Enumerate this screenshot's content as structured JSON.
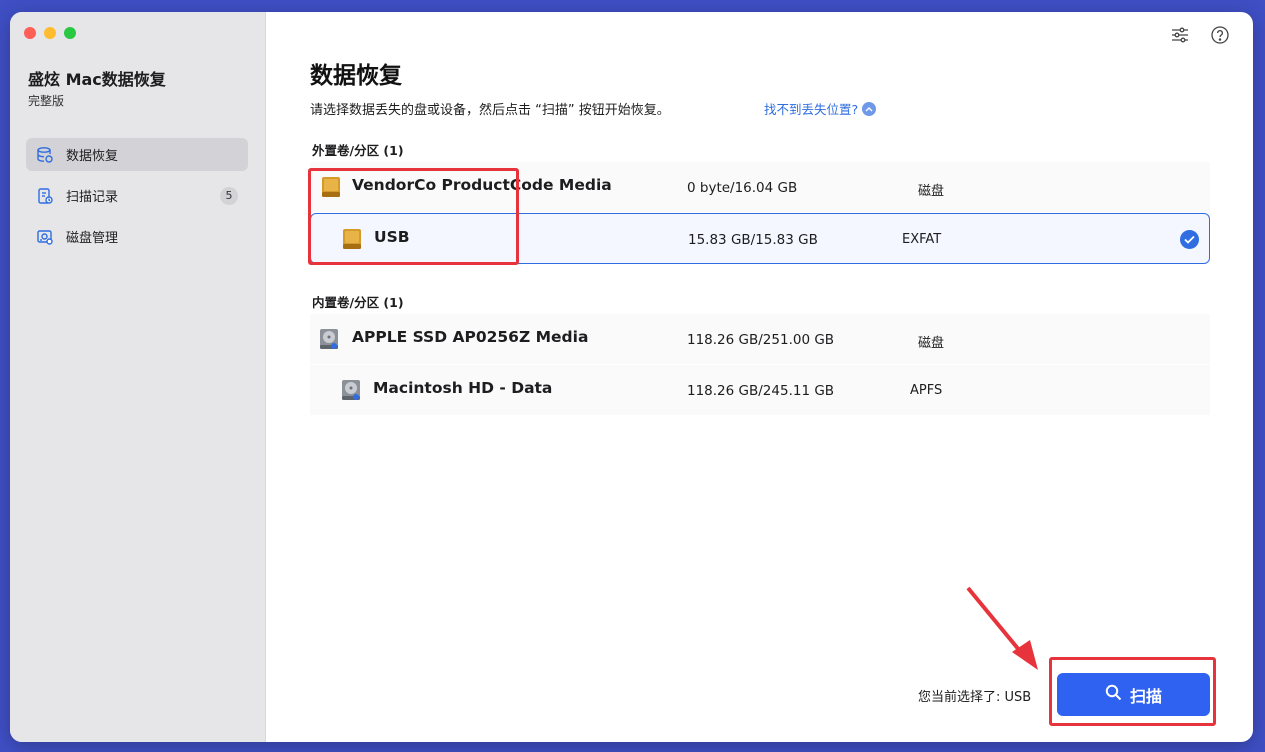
{
  "app": {
    "title": "盛炫 Mac数据恢复",
    "edition": "完整版"
  },
  "sidebar": {
    "items": [
      {
        "label": "数据恢复",
        "icon": "database-icon",
        "active": true
      },
      {
        "label": "扫描记录",
        "icon": "scan-history-icon",
        "badge": "5"
      },
      {
        "label": "磁盘管理",
        "icon": "disk-management-icon"
      }
    ]
  },
  "toolbar": {
    "icons": [
      "settings-sliders-icon",
      "help-icon"
    ]
  },
  "main": {
    "title": "数据恢复",
    "subtitle": "请选择数据丢失的盘或设备，然后点击 “扫描” 按钮开始恢复。",
    "help_link": "找不到丢失位置?",
    "sections": [
      {
        "label": "外置卷/分区 (1)",
        "drives": [
          {
            "name": "VendorCo ProductCode Media",
            "size": "0 byte/16.04 GB",
            "type": "磁盘",
            "icon": "external-drive-icon"
          },
          {
            "name": "USB",
            "size": "15.83 GB/15.83 GB",
            "type": "EXFAT",
            "icon": "external-drive-icon",
            "selected": true
          }
        ]
      },
      {
        "label": "内置卷/分区 (1)",
        "drives": [
          {
            "name": "APPLE SSD AP0256Z Media",
            "size": "118.26 GB/251.00 GB",
            "type": "磁盘",
            "icon": "internal-drive-icon"
          },
          {
            "name": "Macintosh HD - Data",
            "size": "118.26 GB/245.11 GB",
            "type": "APFS",
            "icon": "internal-drive-icon"
          }
        ]
      }
    ]
  },
  "footer": {
    "selection_label": "您当前选择了: USB",
    "scan_button": "扫描"
  },
  "colors": {
    "accent": "#2f62f0",
    "highlight": "#e7333b",
    "sidebar_bg": "#e6e6e8"
  }
}
